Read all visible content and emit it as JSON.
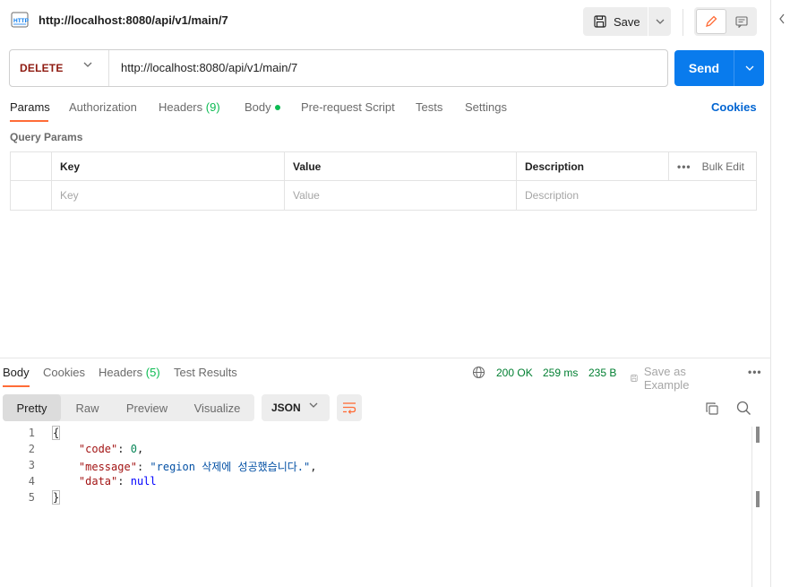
{
  "request": {
    "icon_label": "HTTP",
    "title": "http://localhost:8080/api/v1/main/7",
    "method": "DELETE",
    "url": "http://localhost:8080/api/v1/main/7"
  },
  "toolbar": {
    "save_label": "Save",
    "send_label": "Send"
  },
  "request_tabs": {
    "params": "Params",
    "authorization": "Authorization",
    "headers": "Headers",
    "headers_count": "(9)",
    "body": "Body",
    "pre_request": "Pre-request Script",
    "tests": "Tests",
    "settings": "Settings",
    "cookies": "Cookies"
  },
  "query_params": {
    "title": "Query Params",
    "columns": [
      "Key",
      "Value",
      "Description"
    ],
    "bulk_edit": "Bulk Edit",
    "placeholders": [
      "Key",
      "Value",
      "Description"
    ]
  },
  "response": {
    "tabs": {
      "body": "Body",
      "cookies": "Cookies",
      "headers": "Headers",
      "headers_count": "(5)",
      "test_results": "Test Results"
    },
    "status": "200 OK",
    "time": "259 ms",
    "size": "235 B",
    "save_example": "Save as Example",
    "formats": [
      "Pretty",
      "Raw",
      "Preview",
      "Visualize"
    ],
    "language": "JSON",
    "lines": [
      {
        "num": "1"
      },
      {
        "num": "2",
        "key": "\"code\"",
        "value": "0"
      },
      {
        "num": "3",
        "key": "\"message\"",
        "value": "\"region 삭제에 성공했습니다.\""
      },
      {
        "num": "4",
        "key": "\"data\"",
        "value": "null"
      },
      {
        "num": "5"
      }
    ],
    "open_brace": "{",
    "close_brace": "}"
  },
  "colors": {
    "accent": "#ff6c37",
    "send": "#097bed",
    "method_delete": "#8e1a10",
    "status_ok": "#007f31",
    "link": "#0265d2"
  }
}
